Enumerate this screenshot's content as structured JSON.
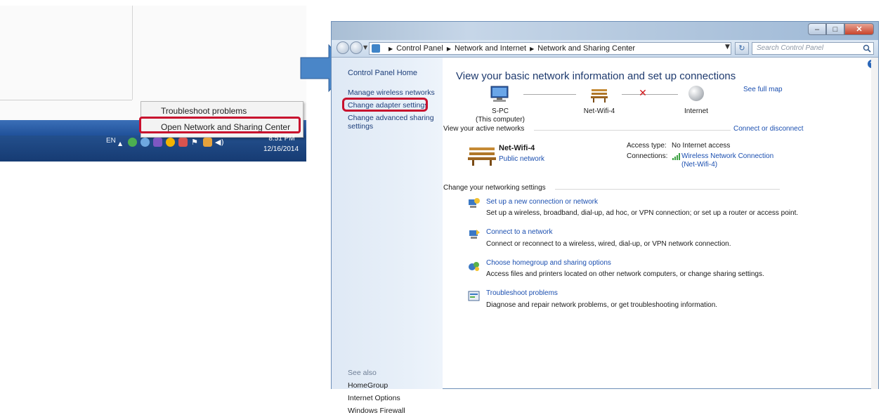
{
  "taskbar_popup": {
    "menu_items": [
      "Troubleshoot problems",
      "Open Network and Sharing Center"
    ],
    "language": "EN",
    "time": "8:51 PM",
    "date": "12/16/2014"
  },
  "window": {
    "breadcrumb": [
      "Control Panel",
      "Network and Internet",
      "Network and Sharing Center"
    ],
    "search_placeholder": "Search Control Panel",
    "left_pane": {
      "home": "Control Panel Home",
      "links": [
        "Manage wireless networks",
        "Change adapter settings",
        "Change advanced sharing",
        "settings"
      ],
      "see_also_heading": "See also",
      "see_also": [
        "HomeGroup",
        "Internet Options",
        "Windows Firewall"
      ]
    },
    "content": {
      "title": "View your basic network information and set up connections",
      "see_full_map": "See full map",
      "map": {
        "computer_name": "S-PC",
        "computer_sub": "(This computer)",
        "network_name": "Net-Wifi-4",
        "internet": "Internet"
      },
      "active_networks_heading": "View your active networks",
      "connect_or_disconnect": "Connect or disconnect",
      "active_network": {
        "name": "Net-Wifi-4",
        "category": "Public network",
        "access_type_label": "Access type:",
        "access_type_value": "No Internet access",
        "connections_label": "Connections:",
        "connection_line1": "Wireless Network Connection",
        "connection_line2": "(Net-Wifi-4)"
      },
      "change_settings_heading": "Change your networking settings",
      "tasks": [
        {
          "link": "Set up a new connection or network",
          "desc": "Set up a wireless, broadband, dial-up, ad hoc, or VPN connection; or set up a router or access point."
        },
        {
          "link": "Connect to a network",
          "desc": "Connect or reconnect to a wireless, wired, dial-up, or VPN network connection."
        },
        {
          "link": "Choose homegroup and sharing options",
          "desc": "Access files and printers located on other network computers, or change sharing settings."
        },
        {
          "link": "Troubleshoot problems",
          "desc": "Diagnose and repair network problems, or get troubleshooting information."
        }
      ]
    }
  },
  "colors": {
    "highlight_red": "#c8102e",
    "link_blue": "#1b4fb0",
    "arrow_blue": "#4a86c8"
  }
}
